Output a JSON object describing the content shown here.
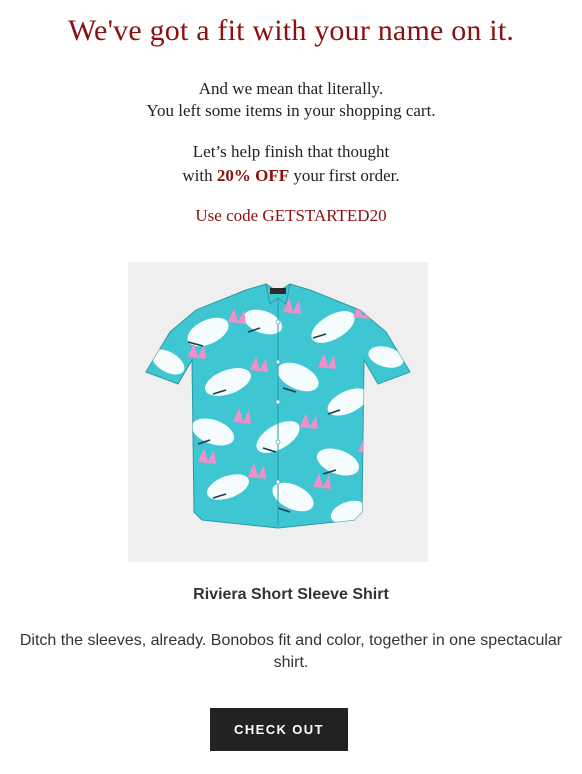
{
  "email": {
    "headline": "We've got a fit with your name on it.",
    "intro_line1": "And we mean that literally.",
    "intro_line2": "You left some items in your shopping cart.",
    "offer_line1": "Let’s help finish that thought",
    "offer_prefix": "with ",
    "offer_highlight": "20% OFF",
    "offer_suffix": " your first order.",
    "code_text": "Use code GETSTARTED20"
  },
  "product": {
    "image_icon": "shirt-image",
    "name": "Riviera Short Sleeve Shirt",
    "description": "Ditch the sleeves, already. Bonobos fit and color, together in one spectacular shirt."
  },
  "cta": {
    "label": "CHECK OUT"
  },
  "colors": {
    "accent": "#8b1010",
    "button_bg": "#222222",
    "shirt_base": "#3fc6d3",
    "shirt_pattern_white": "#ffffff",
    "shirt_pattern_pink": "#f28ec8"
  }
}
